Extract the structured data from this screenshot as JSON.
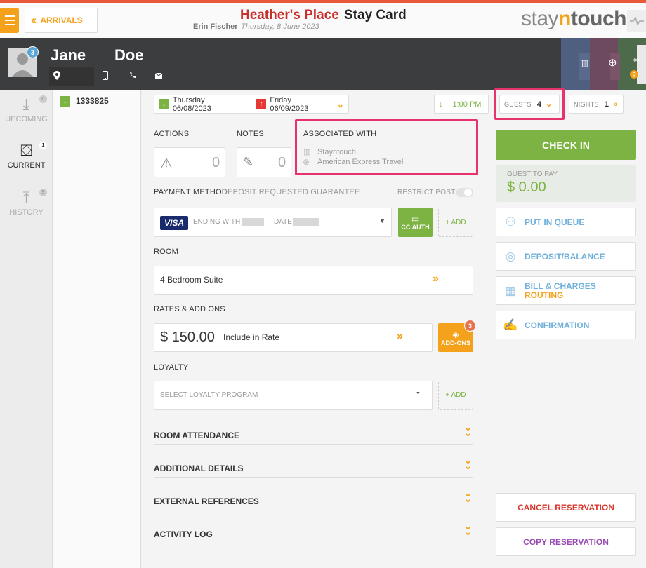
{
  "header": {
    "back_label": "ARRIVALS",
    "hotel_name": "Heather's Place",
    "page_title": "Stay Card",
    "user_name": "Erin Fischer",
    "business_date": "Thursday, 8 June 2023",
    "logo_part1": "stay",
    "logo_part2": "n",
    "logo_part3": "touch"
  },
  "guest": {
    "first_name": "Jane",
    "last_name": "Doe",
    "avatar_badge": "3"
  },
  "left_nav": {
    "upcoming": {
      "label": "UPCOMING",
      "count": "0"
    },
    "current": {
      "label": "CURRENT",
      "count": "1"
    },
    "history": {
      "label": "HISTORY",
      "count": "9"
    }
  },
  "reservation": {
    "number": "1333825"
  },
  "dates": {
    "arrival": "Thursday 06/08/2023",
    "departure": "Friday 06/09/2023",
    "arrival_time": "1:00 PM",
    "guests_label": "GUESTS",
    "guests_value": "4",
    "nights_label": "NIGHTS",
    "nights_value": "1"
  },
  "actions": {
    "label": "ACTIONS",
    "count": "0"
  },
  "notes": {
    "label": "NOTES",
    "count": "0"
  },
  "associated": {
    "label": "ASSOCIATED WITH",
    "company": "Stayntouch",
    "travel_agent": "American Express Travel"
  },
  "payment": {
    "label": "PAYMENT METHOD",
    "type": "DEPOSIT REQUESTED GUARANTEE",
    "restrict_post_label": "RESTRICT POST",
    "card_brand": "VISA",
    "ending_with_label": "ENDING WITH",
    "date_label": "DATE",
    "cc_auth_label": "CC AUTH",
    "add_label": "+ ADD"
  },
  "room": {
    "label": "ROOM",
    "type": "4 Bedroom Suite"
  },
  "rates": {
    "label": "RATES & ADD ONS",
    "amount": "$ 150.00",
    "description": "Include in Rate",
    "addons_label": "ADD-ONS",
    "addons_count": "3"
  },
  "loyalty": {
    "label": "LOYALTY",
    "placeholder": "SELECT LOYALTY PROGRAM",
    "add_label": "+ ADD"
  },
  "sections": [
    "ROOM ATTENDANCE",
    "ADDITIONAL DETAILS",
    "EXTERNAL REFERENCES",
    "ACTIVITY LOG"
  ],
  "sidebar": {
    "check_in_label": "CHECK IN",
    "guest_to_pay_label": "GUEST TO PAY",
    "guest_to_pay_amount": "$ 0.00",
    "put_in_queue": "PUT IN QUEUE",
    "deposit_balance": "DEPOSIT/BALANCE",
    "bill_charges": "BILL & CHARGES",
    "routing": "ROUTING",
    "confirmation": "CONFIRMATION",
    "cancel_reservation": "CANCEL RESERVATION",
    "copy_reservation": "COPY RESERVATION"
  },
  "colors": {
    "accent_orange": "#f4a21b",
    "check_in_green": "#7cb342",
    "brand_red": "#c8302b",
    "highlight_pink": "#e8326c",
    "link_blue": "#6fb0db"
  }
}
